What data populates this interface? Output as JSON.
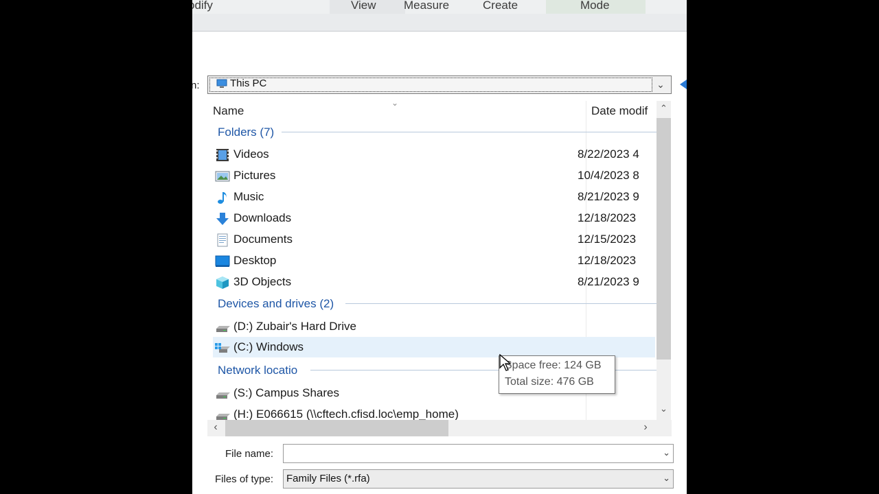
{
  "ribbon": {
    "tabs": [
      "odify",
      "View",
      "Measure",
      "Create",
      "Mode"
    ]
  },
  "dialog": {
    "look_in_label": "n:",
    "look_in_value": "This PC",
    "columns": {
      "name": "Name",
      "date": "Date modif"
    },
    "groups": {
      "folders": "Folders (7)",
      "devices": "Devices and drives (2)",
      "network": "Network locatio"
    },
    "folders": [
      {
        "name": "Videos",
        "date": "8/22/2023 4",
        "icon": "videos-folder-icon"
      },
      {
        "name": "Pictures",
        "date": "10/4/2023 8",
        "icon": "pictures-folder-icon"
      },
      {
        "name": "Music",
        "date": "8/21/2023 9",
        "icon": "music-folder-icon"
      },
      {
        "name": "Downloads",
        "date": "12/18/2023",
        "icon": "downloads-folder-icon"
      },
      {
        "name": "Documents",
        "date": "12/15/2023",
        "icon": "documents-folder-icon"
      },
      {
        "name": "Desktop",
        "date": "12/18/2023",
        "icon": "desktop-folder-icon"
      },
      {
        "name": "3D Objects",
        "date": "8/21/2023 9",
        "icon": "3d-objects-folder-icon"
      }
    ],
    "drives": [
      {
        "name": "(D:) Zubair's Hard Drive",
        "icon": "hard-drive-icon"
      },
      {
        "name": "(C:) Windows",
        "icon": "windows-drive-icon",
        "selected": true
      }
    ],
    "network": [
      {
        "name": "(S:) Campus Shares",
        "icon": "network-drive-icon"
      },
      {
        "name": "(H:) E066615 (\\\\cftech.cfisd.loc\\emp_home)",
        "icon": "network-drive-icon"
      }
    ],
    "tooltip": {
      "line1": "Space free: 124 GB",
      "line2": "Total size: 476 GB"
    },
    "file_name": {
      "label": "File name:",
      "value": ""
    },
    "file_type": {
      "label": "Files of type:",
      "value": "Family Files  (*.rfa)"
    }
  },
  "colors": {
    "group_text": "#1e56a6",
    "selection": "#e5f1fb"
  }
}
